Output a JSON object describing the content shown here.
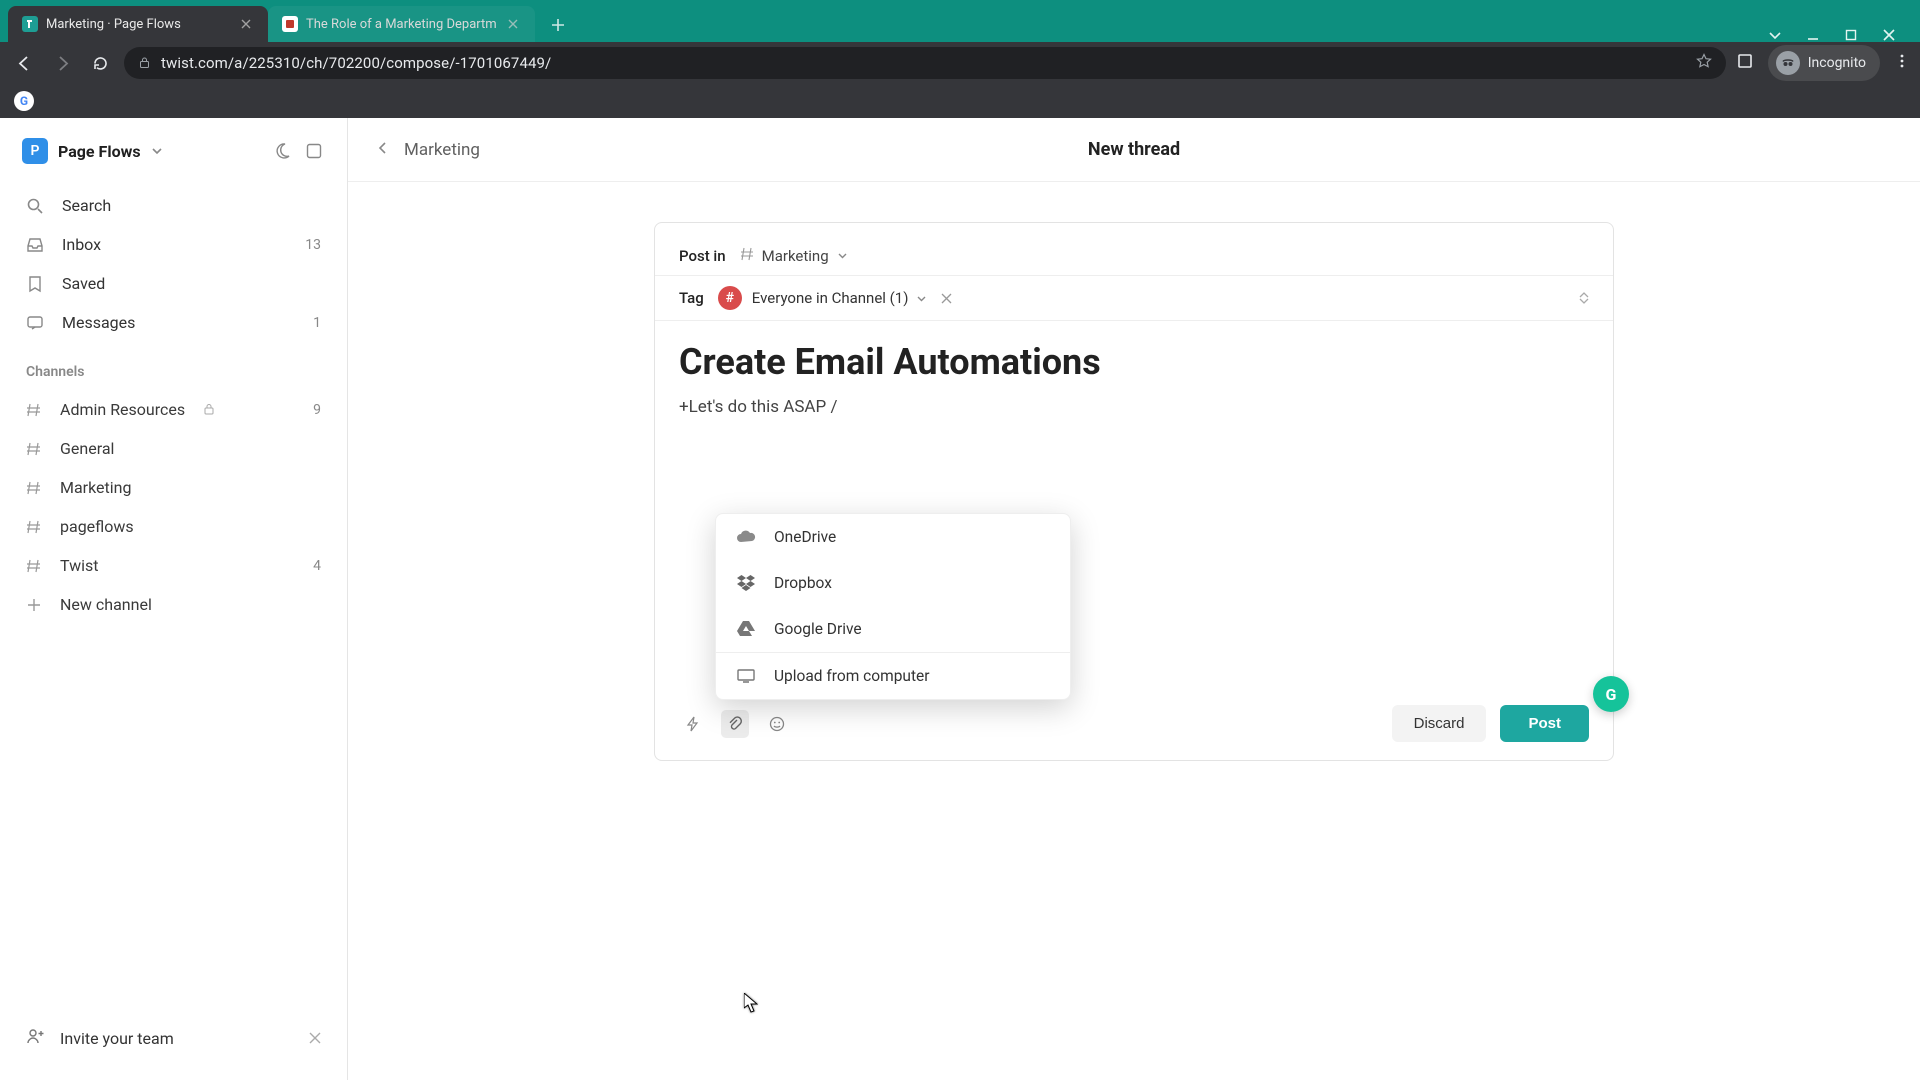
{
  "browser": {
    "tabs": [
      {
        "title": "Marketing · Page Flows",
        "active": true
      },
      {
        "title": "The Role of a Marketing Departm",
        "active": false
      }
    ],
    "url": "twist.com/a/225310/ch/702200/compose/-1701067449/",
    "incognito_label": "Incognito"
  },
  "workspace": {
    "badge_letter": "P",
    "name": "Page Flows"
  },
  "sidebar": {
    "items": [
      {
        "label": "Search",
        "count": null
      },
      {
        "label": "Inbox",
        "count": "13"
      },
      {
        "label": "Saved",
        "count": null
      },
      {
        "label": "Messages",
        "count": "1"
      }
    ],
    "channels_label": "Channels",
    "channels": [
      {
        "name": "Admin Resources",
        "count": "9",
        "locked": true
      },
      {
        "name": "General",
        "count": null,
        "locked": false
      },
      {
        "name": "Marketing",
        "count": null,
        "locked": false
      },
      {
        "name": "pageflows",
        "count": null,
        "locked": false
      },
      {
        "name": "Twist",
        "count": "4",
        "locked": false
      }
    ],
    "new_channel_label": "New channel",
    "invite_label": "Invite your team"
  },
  "header": {
    "back_label": "Marketing",
    "title": "New thread"
  },
  "compose": {
    "post_in_label": "Post in",
    "channel": "Marketing",
    "tag_label": "Tag",
    "tag_badge": "#",
    "tag_text": "Everyone in Channel (1)",
    "title": "Create Email Automations",
    "body": "+Let's do this ASAP /",
    "discard_label": "Discard",
    "post_label": "Post"
  },
  "attach_menu": {
    "items": [
      "OneDrive",
      "Dropbox",
      "Google Drive",
      "Upload from computer"
    ]
  },
  "grammarly_letter": "G"
}
